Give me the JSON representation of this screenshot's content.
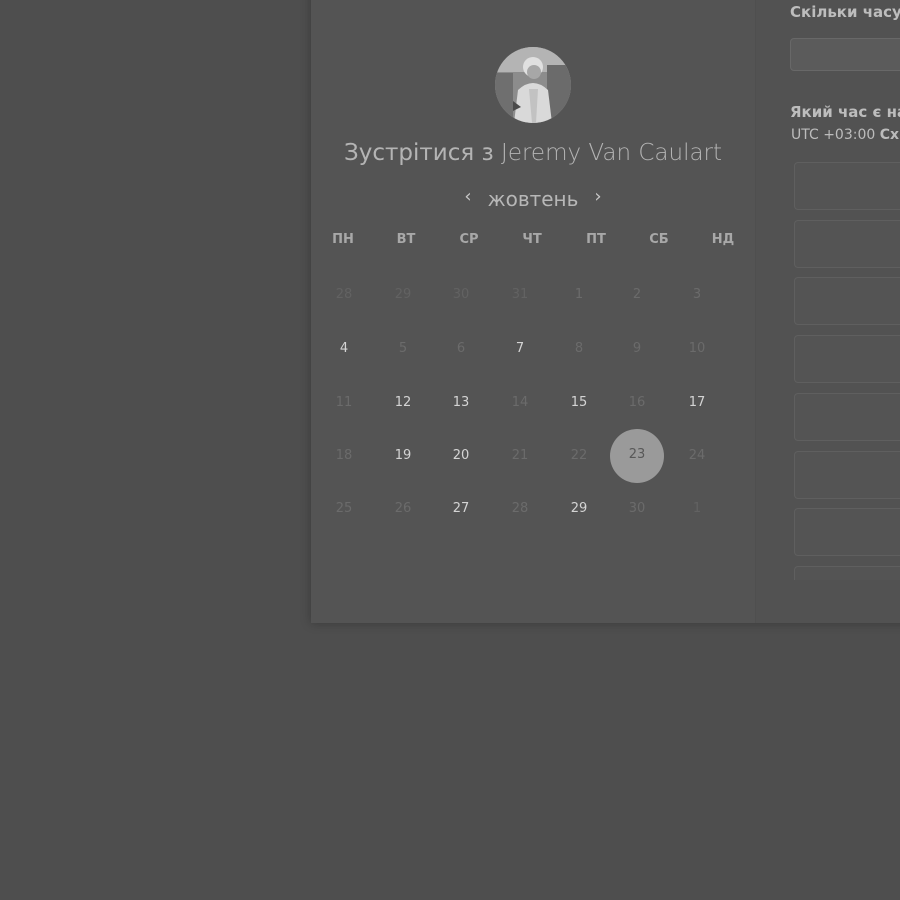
{
  "calendar": {
    "avatar": "avatar-photo",
    "title_prefix": "Зустрітися з",
    "host_name": "Jeremy Van Caulart",
    "month": "жовтень",
    "weekdays": [
      "ПН",
      "ВТ",
      "СР",
      "ЧТ",
      "ПТ",
      "СБ",
      "НД"
    ],
    "weeks": [
      [
        "28",
        "29",
        "30",
        "31",
        "1",
        "2",
        "3"
      ],
      [
        "4",
        "5",
        "6",
        "7",
        "8",
        "9",
        "10"
      ],
      [
        "11",
        "12",
        "13",
        "14",
        "15",
        "16",
        "17"
      ],
      [
        "18",
        "19",
        "20",
        "21",
        "22",
        "23",
        "24"
      ],
      [
        "25",
        "26",
        "27",
        "28",
        "29",
        "30",
        "1"
      ]
    ],
    "selected_day": "23",
    "available_days": [
      "4",
      "7",
      "12",
      "13",
      "15",
      "17",
      "19",
      "20",
      "27",
      "29"
    ]
  },
  "booking": {
    "duration_label": "Скільки часу",
    "time_question": "Який час є на",
    "timezone_prefix": "UTC +03:00",
    "timezone_name": "Схі",
    "slot_count": 8
  },
  "icons": {
    "prev": "chevron-left-icon",
    "next": "chevron-right-icon"
  }
}
